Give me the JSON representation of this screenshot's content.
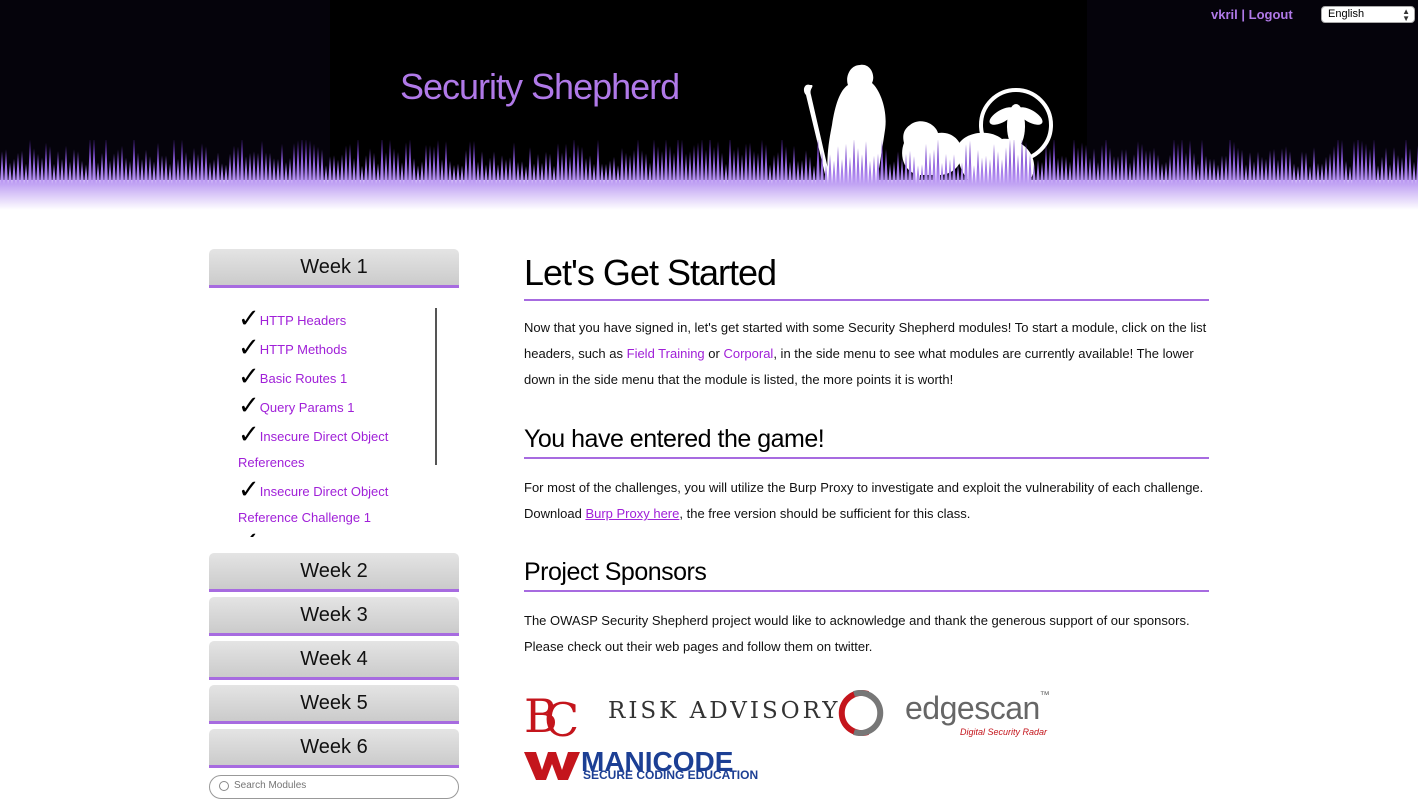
{
  "header": {
    "site_title": "Security Shepherd",
    "user": "vkril",
    "separator": "|",
    "logout": "Logout",
    "language": "English"
  },
  "sidebar": {
    "weeks": [
      "Week 1",
      "Week 2",
      "Week 3",
      "Week 4",
      "Week 5",
      "Week 6"
    ],
    "week1_modules": [
      {
        "line1": "HTTP Headers",
        "line2": ""
      },
      {
        "line1": "HTTP Methods",
        "line2": ""
      },
      {
        "line1": "Basic Routes 1",
        "line2": ""
      },
      {
        "line1": "Query Params 1",
        "line2": ""
      },
      {
        "line1": "Insecure Direct Object",
        "line2": "References"
      },
      {
        "line1": "Insecure Direct Object",
        "line2": "Reference Challenge 1"
      }
    ],
    "check_glyph": "✓",
    "search_placeholder": "Search Modules"
  },
  "main": {
    "title": "Let's Get Started",
    "p1_a": "Now that you have signed in, let's get started with some Security Shepherd modules! To start a module, click on the list headers, such as ",
    "p1_link1": "Field Training",
    "p1_b": " or ",
    "p1_link2": "Corporal",
    "p1_c": ", in the side menu to see what modules are currently available! The lower down in the side menu that the module is listed, the more points it is worth!",
    "h2_game": "You have entered the game!",
    "p2_a": "For most of the challenges, you will utilize the Burp Proxy to investigate and exploit the vulnerability of each challenge. Download ",
    "p2_link": "Burp Proxy here",
    "p2_b": ", the free version should be sufficient for this class.",
    "h2_sponsors": "Project Sponsors",
    "p3": "The OWASP Security Shepherd project would like to acknowledge and thank the generous support of our sponsors. Please check out their web pages and follow them on twitter."
  },
  "sponsors": {
    "risk_advisory": "RISK ADVISORY",
    "edgescan": "edgescan",
    "edgescan_tm": "™",
    "edgescan_tag": "Digital Security Radar",
    "manicode": "MANICODE",
    "manicode_tag": "SECURE CODING EDUCATION"
  },
  "colors": {
    "accent": "#a76be0",
    "link": "#a020d8",
    "title": "#b079e8",
    "header_bg": "#000000",
    "bcc_red": "#c4151c",
    "manicode_blue": "#1c3f94"
  }
}
